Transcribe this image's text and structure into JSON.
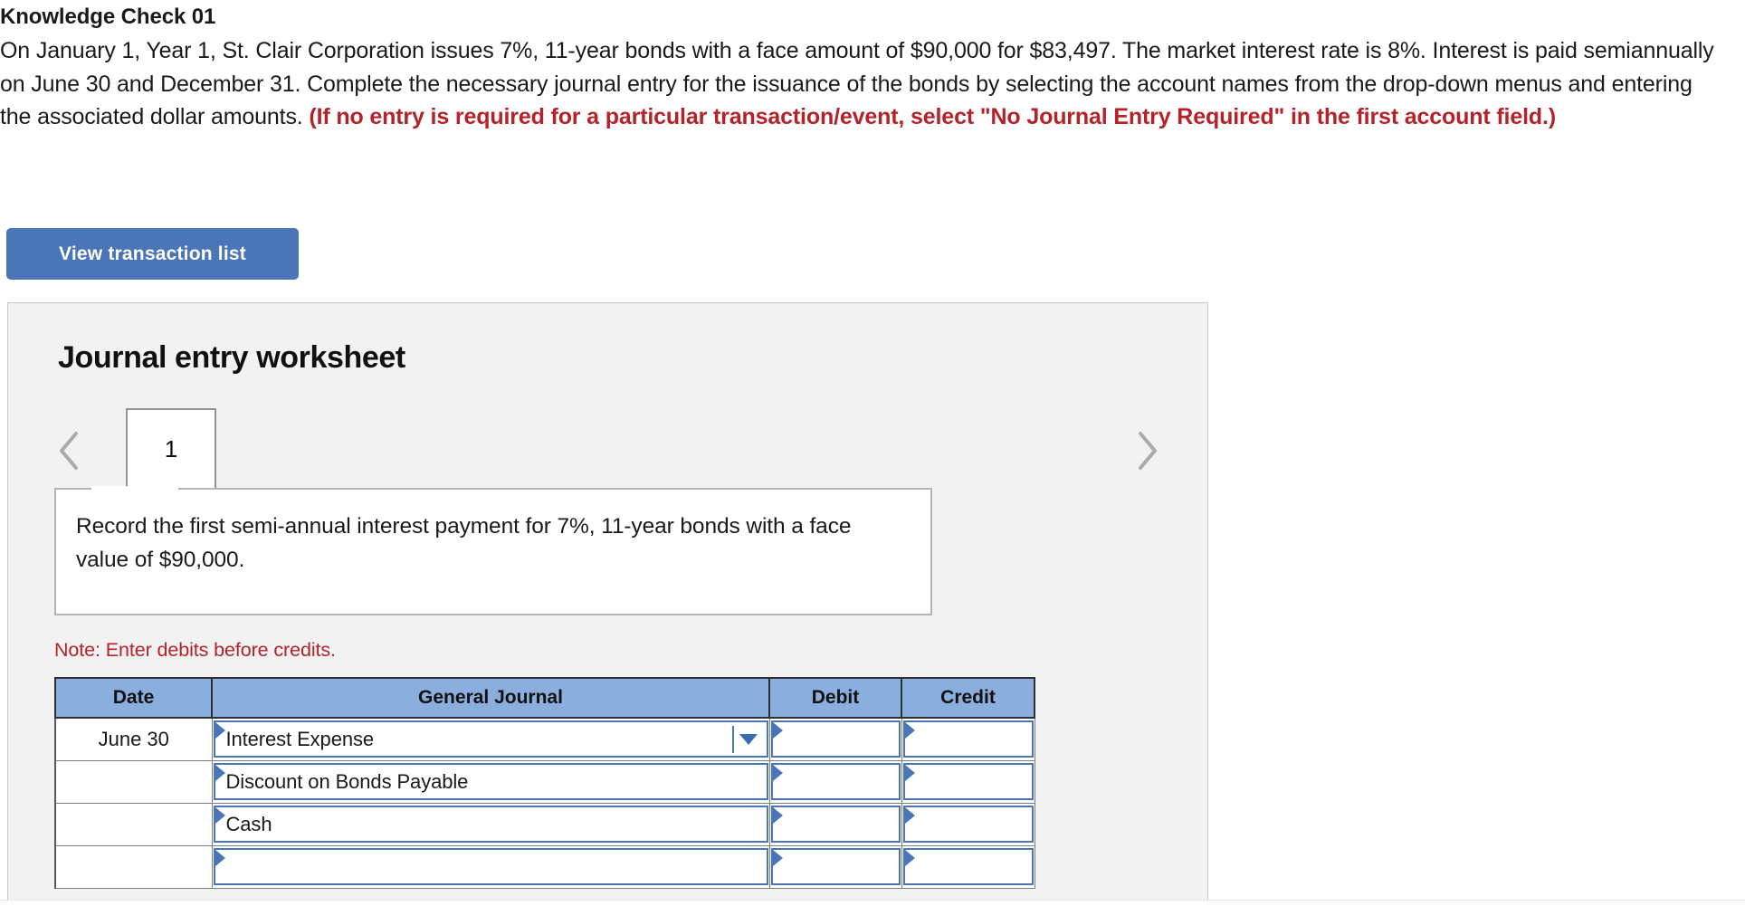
{
  "question": {
    "title": "Knowledge Check 01",
    "body_part1": "On January 1, Year 1, St. Clair Corporation issues 7%, 11-year bonds with a face amount of $90,000 for $83,497. The market interest rate is 8%. Interest is paid semiannually on June 30 and December 31. Complete the necessary journal entry for the issuance of the bonds by selecting the account names from the drop-down menus and entering the associated dollar amounts. ",
    "body_highlight": "(If no entry is required for a particular transaction/event, select \"No Journal Entry Required\" in the first account field.)",
    "highlight_color": "#b4232a"
  },
  "toolbar": {
    "view_transaction_list_label": "View transaction list",
    "button_color": "#4a76b8"
  },
  "worksheet": {
    "title": "Journal entry worksheet",
    "panel_bg": "#f2f2f2",
    "nav": {
      "prev_icon": "chevron-left-icon",
      "next_icon": "chevron-right-icon"
    },
    "tabs": [
      {
        "label": "1",
        "active": true
      }
    ],
    "description": "Record the first semi-annual interest payment for 7%, 11-year bonds with a face value of $90,000.",
    "note": "Note: Enter debits before credits.",
    "note_color": "#b4232a",
    "table": {
      "header_color": "#8aafde",
      "field_border_color": "#4a76b8",
      "columns": [
        "Date",
        "General Journal",
        "Debit",
        "Credit"
      ],
      "rows": [
        {
          "date": "June 30",
          "account": "Interest Expense",
          "debit": "",
          "credit": "",
          "has_dropdown": true
        },
        {
          "date": "",
          "account": "Discount on Bonds Payable",
          "debit": "",
          "credit": "",
          "has_dropdown": false
        },
        {
          "date": "",
          "account": "Cash",
          "debit": "",
          "credit": "",
          "has_dropdown": false
        },
        {
          "date": "",
          "account": "",
          "debit": "",
          "credit": "",
          "has_dropdown": false
        }
      ]
    }
  }
}
